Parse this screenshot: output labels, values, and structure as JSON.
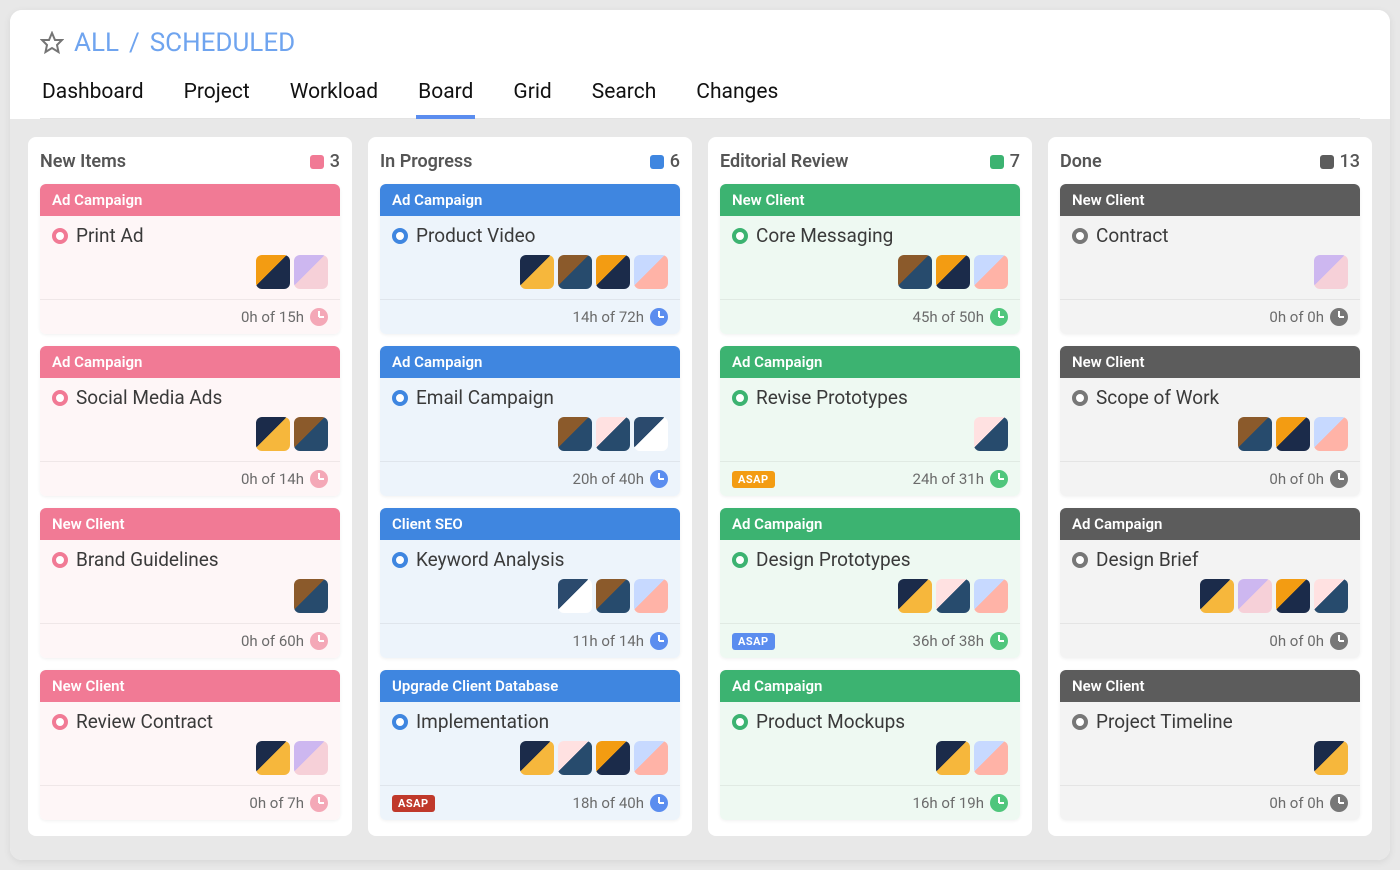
{
  "breadcrumb": {
    "all": "ALL",
    "separator": "/",
    "scheduled": "SCHEDULED"
  },
  "tabs": [
    "Dashboard",
    "Project",
    "Workload",
    "Board",
    "Grid",
    "Search",
    "Changes"
  ],
  "active_tab": "Board",
  "columns": [
    {
      "id": "new-items",
      "title": "New Items",
      "count": 3,
      "color_class": "col-pink",
      "sq_color": "#f17a95",
      "cards": [
        {
          "tag": "Ad Campaign",
          "title": "Print Ad",
          "avatars": [
            "av1",
            "av2"
          ],
          "time": "0h of 15h"
        },
        {
          "tag": "Ad Campaign",
          "title": "Social Media Ads",
          "avatars": [
            "av3",
            "av4"
          ],
          "time": "0h of 14h"
        },
        {
          "tag": "New Client",
          "title": "Brand Guidelines",
          "avatars": [
            "av4"
          ],
          "time": "0h of 60h"
        },
        {
          "tag": "New Client",
          "title": "Review Contract",
          "avatars": [
            "av3",
            "av2"
          ],
          "time": "0h of 7h"
        }
      ]
    },
    {
      "id": "in-progress",
      "title": "In Progress",
      "count": 6,
      "color_class": "col-blue",
      "sq_color": "#3f86e0",
      "cards": [
        {
          "tag": "Ad Campaign",
          "title": "Product Video",
          "avatars": [
            "av3",
            "av4",
            "av1",
            "av6"
          ],
          "time": "14h of 72h"
        },
        {
          "tag": "Ad Campaign",
          "title": "Email Campaign",
          "avatars": [
            "av4",
            "av5",
            "av8"
          ],
          "time": "20h of 40h"
        },
        {
          "tag": "Client SEO",
          "title": "Keyword Analysis",
          "avatars": [
            "av8",
            "av4",
            "av6"
          ],
          "time": "11h of 14h"
        },
        {
          "tag": "Upgrade Client Database",
          "title": "Implementation",
          "avatars": [
            "av3",
            "av5",
            "av1",
            "av6"
          ],
          "time": "18h of 40h",
          "asap": "ASAP",
          "asap_color": "#c0392b"
        }
      ]
    },
    {
      "id": "editorial-review",
      "title": "Editorial Review",
      "count": 7,
      "color_class": "col-green",
      "sq_color": "#3cb371",
      "cards": [
        {
          "tag": "New Client",
          "title": "Core Messaging",
          "avatars": [
            "av4",
            "av1",
            "av6"
          ],
          "time": "45h of 50h"
        },
        {
          "tag": "Ad Campaign",
          "title": "Revise Prototypes",
          "avatars": [
            "av5"
          ],
          "time": "24h of 31h",
          "asap": "ASAP",
          "asap_color": "#f39c12"
        },
        {
          "tag": "Ad Campaign",
          "title": "Design Prototypes",
          "avatars": [
            "av3",
            "av5",
            "av6"
          ],
          "time": "36h of 38h",
          "asap": "ASAP",
          "asap_color": "#5b8def"
        },
        {
          "tag": "Ad Campaign",
          "title": "Product Mockups",
          "avatars": [
            "av3",
            "av6"
          ],
          "time": "16h of 19h"
        }
      ]
    },
    {
      "id": "done",
      "title": "Done",
      "count": 13,
      "color_class": "col-grey",
      "sq_color": "#5c5c5c",
      "cards": [
        {
          "tag": "New Client",
          "title": "Contract",
          "avatars": [
            "av2"
          ],
          "time": "0h of 0h"
        },
        {
          "tag": "New Client",
          "title": "Scope of Work",
          "avatars": [
            "av4",
            "av1",
            "av6"
          ],
          "time": "0h of 0h"
        },
        {
          "tag": "Ad Campaign",
          "title": "Design Brief",
          "avatars": [
            "av3",
            "av2",
            "av1",
            "av5"
          ],
          "time": "0h of 0h"
        },
        {
          "tag": "New Client",
          "title": "Project Timeline",
          "avatars": [
            "av3"
          ],
          "time": "0h of 0h"
        }
      ]
    }
  ]
}
